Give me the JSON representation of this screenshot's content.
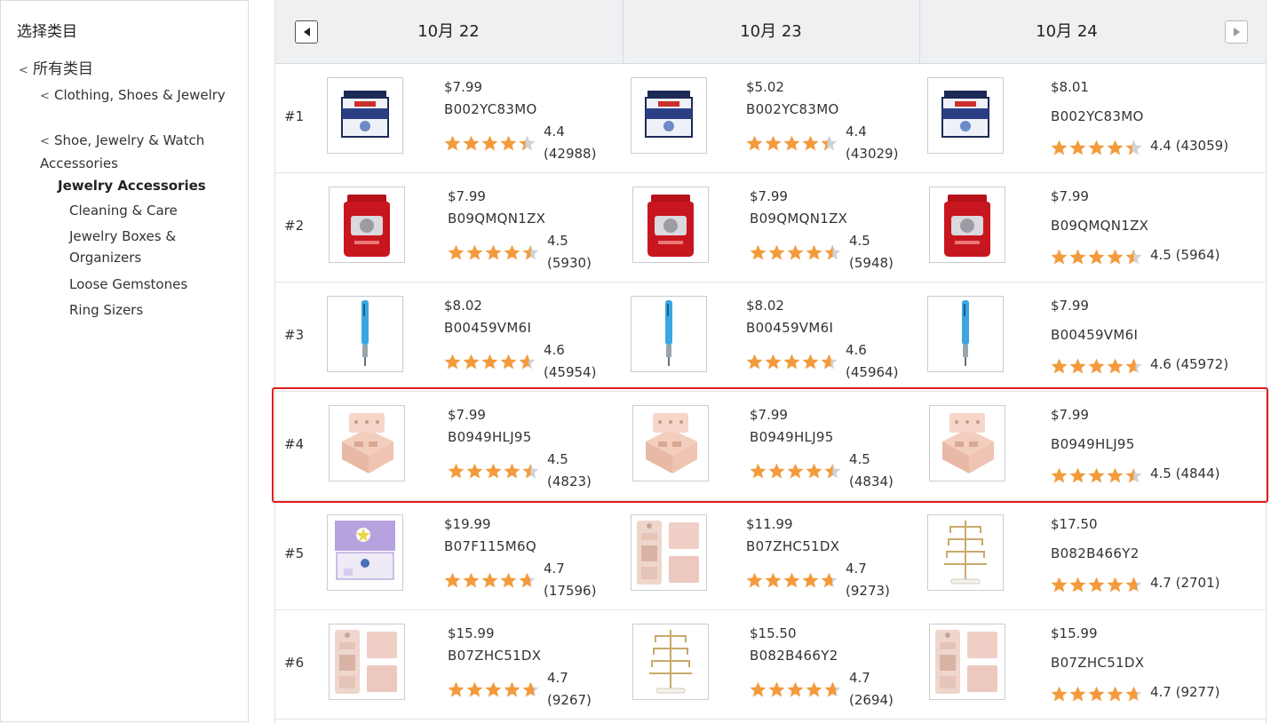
{
  "sidebar": {
    "title": "选择类目",
    "root": "所有类目",
    "level1": [
      "Clothing, Shoes & Jewelry",
      "Shoe, Jewelry & Watch Accessories"
    ],
    "current": "Jewelry Accessories",
    "subcategories": [
      "Cleaning & Care",
      "Jewelry Boxes & Organizers",
      "Loose Gemstones",
      "Ring Sizers"
    ]
  },
  "header": {
    "dates": [
      "10月 22",
      "10月 23",
      "10月 24"
    ]
  },
  "star_color": "#f39a3c",
  "highlight_color": "#e02020",
  "rows": [
    {
      "rank": "#1",
      "cells": [
        {
          "price": "$7.99",
          "asin": "B002YC83MO",
          "rating": "4.4",
          "reviews": "(42988)",
          "image": "jar-navy-icon"
        },
        {
          "price": "$5.02",
          "asin": "B002YC83MO",
          "rating": "4.4",
          "reviews": "(43029)",
          "image": "jar-navy-icon"
        },
        {
          "price": "$8.01",
          "asin": "B002YC83MO",
          "rating": "4.4",
          "reviews": "(43059)",
          "image": "jar-navy-icon"
        }
      ]
    },
    {
      "rank": "#2",
      "cells": [
        {
          "price": "$7.99",
          "asin": "B09QMQN1ZX",
          "rating": "4.5",
          "reviews": "(5930)",
          "image": "jar-red-icon"
        },
        {
          "price": "$7.99",
          "asin": "B09QMQN1ZX",
          "rating": "4.5",
          "reviews": "(5948)",
          "image": "jar-red-icon"
        },
        {
          "price": "$7.99",
          "asin": "B09QMQN1ZX",
          "rating": "4.5",
          "reviews": "(5964)",
          "image": "jar-red-icon"
        }
      ]
    },
    {
      "rank": "#3",
      "cells": [
        {
          "price": "$8.02",
          "asin": "B00459VM6I",
          "rating": "4.6",
          "reviews": "(45954)",
          "image": "pen-blue-icon"
        },
        {
          "price": "$8.02",
          "asin": "B00459VM6I",
          "rating": "4.6",
          "reviews": "(45964)",
          "image": "pen-blue-icon"
        },
        {
          "price": "$7.99",
          "asin": "B00459VM6I",
          "rating": "4.6",
          "reviews": "(45972)",
          "image": "pen-blue-icon"
        }
      ]
    },
    {
      "rank": "#4",
      "cells": [
        {
          "price": "$7.99",
          "asin": "B0949HLJ95",
          "rating": "4.5",
          "reviews": "(4823)",
          "image": "jewelry-box-pink-icon"
        },
        {
          "price": "$7.99",
          "asin": "B0949HLJ95",
          "rating": "4.5",
          "reviews": "(4834)",
          "image": "jewelry-box-pink-icon"
        },
        {
          "price": "$7.99",
          "asin": "B0949HLJ95",
          "rating": "4.5",
          "reviews": "(4844)",
          "image": "jewelry-box-pink-icon"
        }
      ]
    },
    {
      "rank": "#5",
      "cells": [
        {
          "price": "$19.99",
          "asin": "B07F115M6Q",
          "rating": "4.7",
          "reviews": "(17596)",
          "image": "music-box-purple-icon"
        },
        {
          "price": "$11.99",
          "asin": "B07ZHC51DX",
          "rating": "4.7",
          "reviews": "(9273)",
          "image": "roll-organizer-pink-icon"
        },
        {
          "price": "$17.50",
          "asin": "B082B466Y2",
          "rating": "4.7",
          "reviews": "(2701)",
          "image": "jewelry-stand-gold-icon"
        }
      ]
    },
    {
      "rank": "#6",
      "cells": [
        {
          "price": "$15.99",
          "asin": "B07ZHC51DX",
          "rating": "4.7",
          "reviews": "(9267)",
          "image": "roll-organizer-pink-icon"
        },
        {
          "price": "$15.50",
          "asin": "B082B466Y2",
          "rating": "4.7",
          "reviews": "(2694)",
          "image": "jewelry-stand-gold-icon"
        },
        {
          "price": "$15.99",
          "asin": "B07ZHC51DX",
          "rating": "4.7",
          "reviews": "(9277)",
          "image": "roll-organizer-pink-icon"
        }
      ]
    }
  ]
}
